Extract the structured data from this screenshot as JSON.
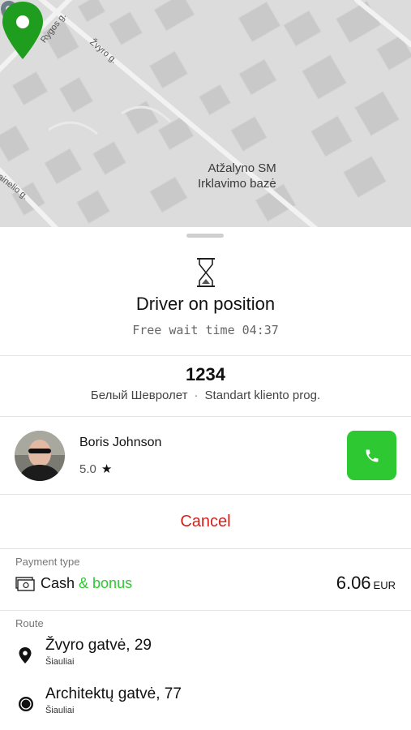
{
  "map": {
    "streets": [
      "Rygos g.",
      "Žvyro g.",
      "ainelio g."
    ],
    "poi_lines": [
      "Atžalyno SM",
      "Irklavimo bazė"
    ],
    "pin_color": "#1f9d1f"
  },
  "status": {
    "title": "Driver on position",
    "wait_label": "Free wait time 04:37"
  },
  "vehicle": {
    "plate": "1234",
    "description": "Белый Шевролет",
    "separator": "·",
    "tariff": "Standart kliento prog."
  },
  "driver": {
    "name": "Boris Johnson",
    "rating": "5.0",
    "star": "★"
  },
  "actions": {
    "cancel_label": "Cancel"
  },
  "payment": {
    "label": "Payment type",
    "method": "Cash",
    "bonus": " & bonus",
    "amount": "6.06",
    "currency": "EUR"
  },
  "route": {
    "label": "Route",
    "stops": [
      {
        "address": "Žvyro gatvė, 29",
        "city": "Šiauliai"
      },
      {
        "address": "Architektų gatvė, 77",
        "city": "Šiauliai"
      }
    ]
  },
  "colors": {
    "accent_green": "#2ec832",
    "cancel_red": "#d0231d"
  }
}
